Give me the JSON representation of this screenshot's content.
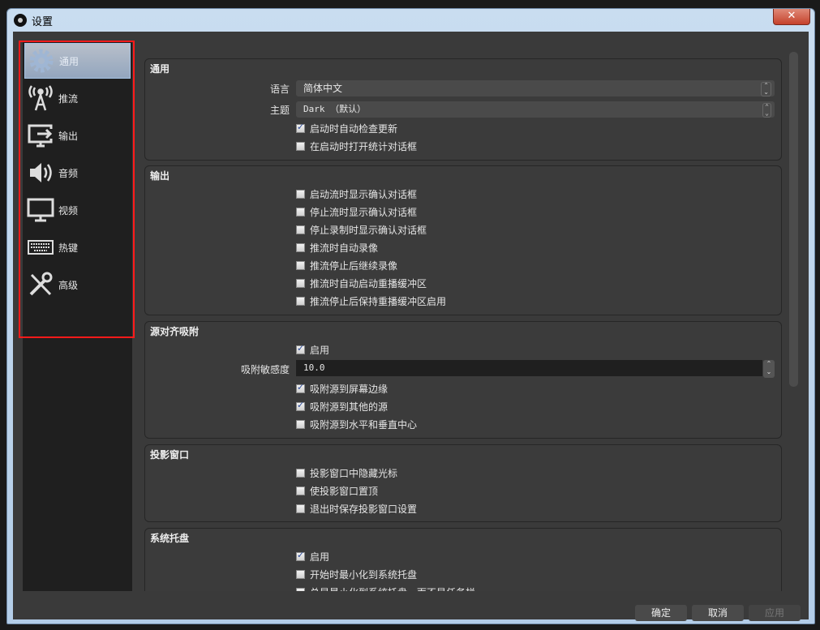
{
  "window": {
    "title": "设置",
    "close_label": "✕"
  },
  "sidebar": {
    "items": [
      {
        "label": "通用",
        "icon": "gear-icon",
        "active": true
      },
      {
        "label": "推流",
        "icon": "antenna-icon"
      },
      {
        "label": "输出",
        "icon": "output-monitor-icon"
      },
      {
        "label": "音频",
        "icon": "speaker-icon"
      },
      {
        "label": "视频",
        "icon": "monitor-icon"
      },
      {
        "label": "热键",
        "icon": "keyboard-icon"
      },
      {
        "label": "高级",
        "icon": "tools-icon"
      }
    ]
  },
  "general": {
    "title": "通用",
    "language_label": "语言",
    "language_value": "简体中文",
    "theme_label": "主题",
    "theme_value": "Dark （默认）",
    "checkboxes": [
      {
        "label": "启动时自动检查更新",
        "checked": true
      },
      {
        "label": "在启动时打开统计对话框",
        "checked": false
      }
    ]
  },
  "output": {
    "title": "输出",
    "checkboxes": [
      {
        "label": "启动流时显示确认对话框",
        "checked": false
      },
      {
        "label": "停止流时显示确认对话框",
        "checked": false
      },
      {
        "label": "停止录制时显示确认对话框",
        "checked": false
      },
      {
        "label": "推流时自动录像",
        "checked": false
      },
      {
        "label": "推流停止后继续录像",
        "checked": false
      },
      {
        "label": "推流时自动启动重播缓冲区",
        "checked": false
      },
      {
        "label": "推流停止后保持重播缓冲区启用",
        "checked": false
      }
    ]
  },
  "snap": {
    "title": "源对齐吸附",
    "enable": {
      "label": "启用",
      "checked": true
    },
    "sensitivity_label": "吸附敏感度",
    "sensitivity_value": "10.0",
    "checkboxes": [
      {
        "label": "吸附源到屏幕边缘",
        "checked": true
      },
      {
        "label": "吸附源到其他的源",
        "checked": true
      },
      {
        "label": "吸附源到水平和垂直中心",
        "checked": false
      }
    ]
  },
  "projector": {
    "title": "投影窗口",
    "checkboxes": [
      {
        "label": "投影窗口中隐藏光标",
        "checked": false
      },
      {
        "label": "使投影窗口置顶",
        "checked": false
      },
      {
        "label": "退出时保存投影窗口设置",
        "checked": false
      }
    ]
  },
  "tray": {
    "title": "系统托盘",
    "checkboxes": [
      {
        "label": "启用",
        "checked": true
      },
      {
        "label": "开始时最小化到系统托盘",
        "checked": false
      },
      {
        "label": "总是最小化到系统托盘，而不是任务栏",
        "checked": false
      }
    ]
  },
  "buttons": {
    "ok": "确定",
    "cancel": "取消",
    "apply": "应用"
  }
}
